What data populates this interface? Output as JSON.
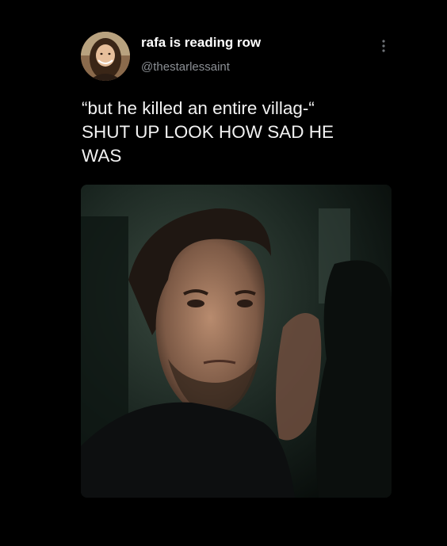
{
  "tweet": {
    "author": {
      "display_name": "rafa is reading row",
      "handle": "@thestarlessaint",
      "avatar_icon": "avatar-photo"
    },
    "more_icon": "more-vertical-icon",
    "text_lines": [
      "“but he killed an entire villag-“",
      "SHUT UP LOOK HOW SAD HE",
      "WAS"
    ],
    "media": {
      "kind": "photo"
    }
  },
  "colors": {
    "background": "#000000",
    "primary_text": "#ffffff",
    "secondary_text": "#8b8f94"
  }
}
